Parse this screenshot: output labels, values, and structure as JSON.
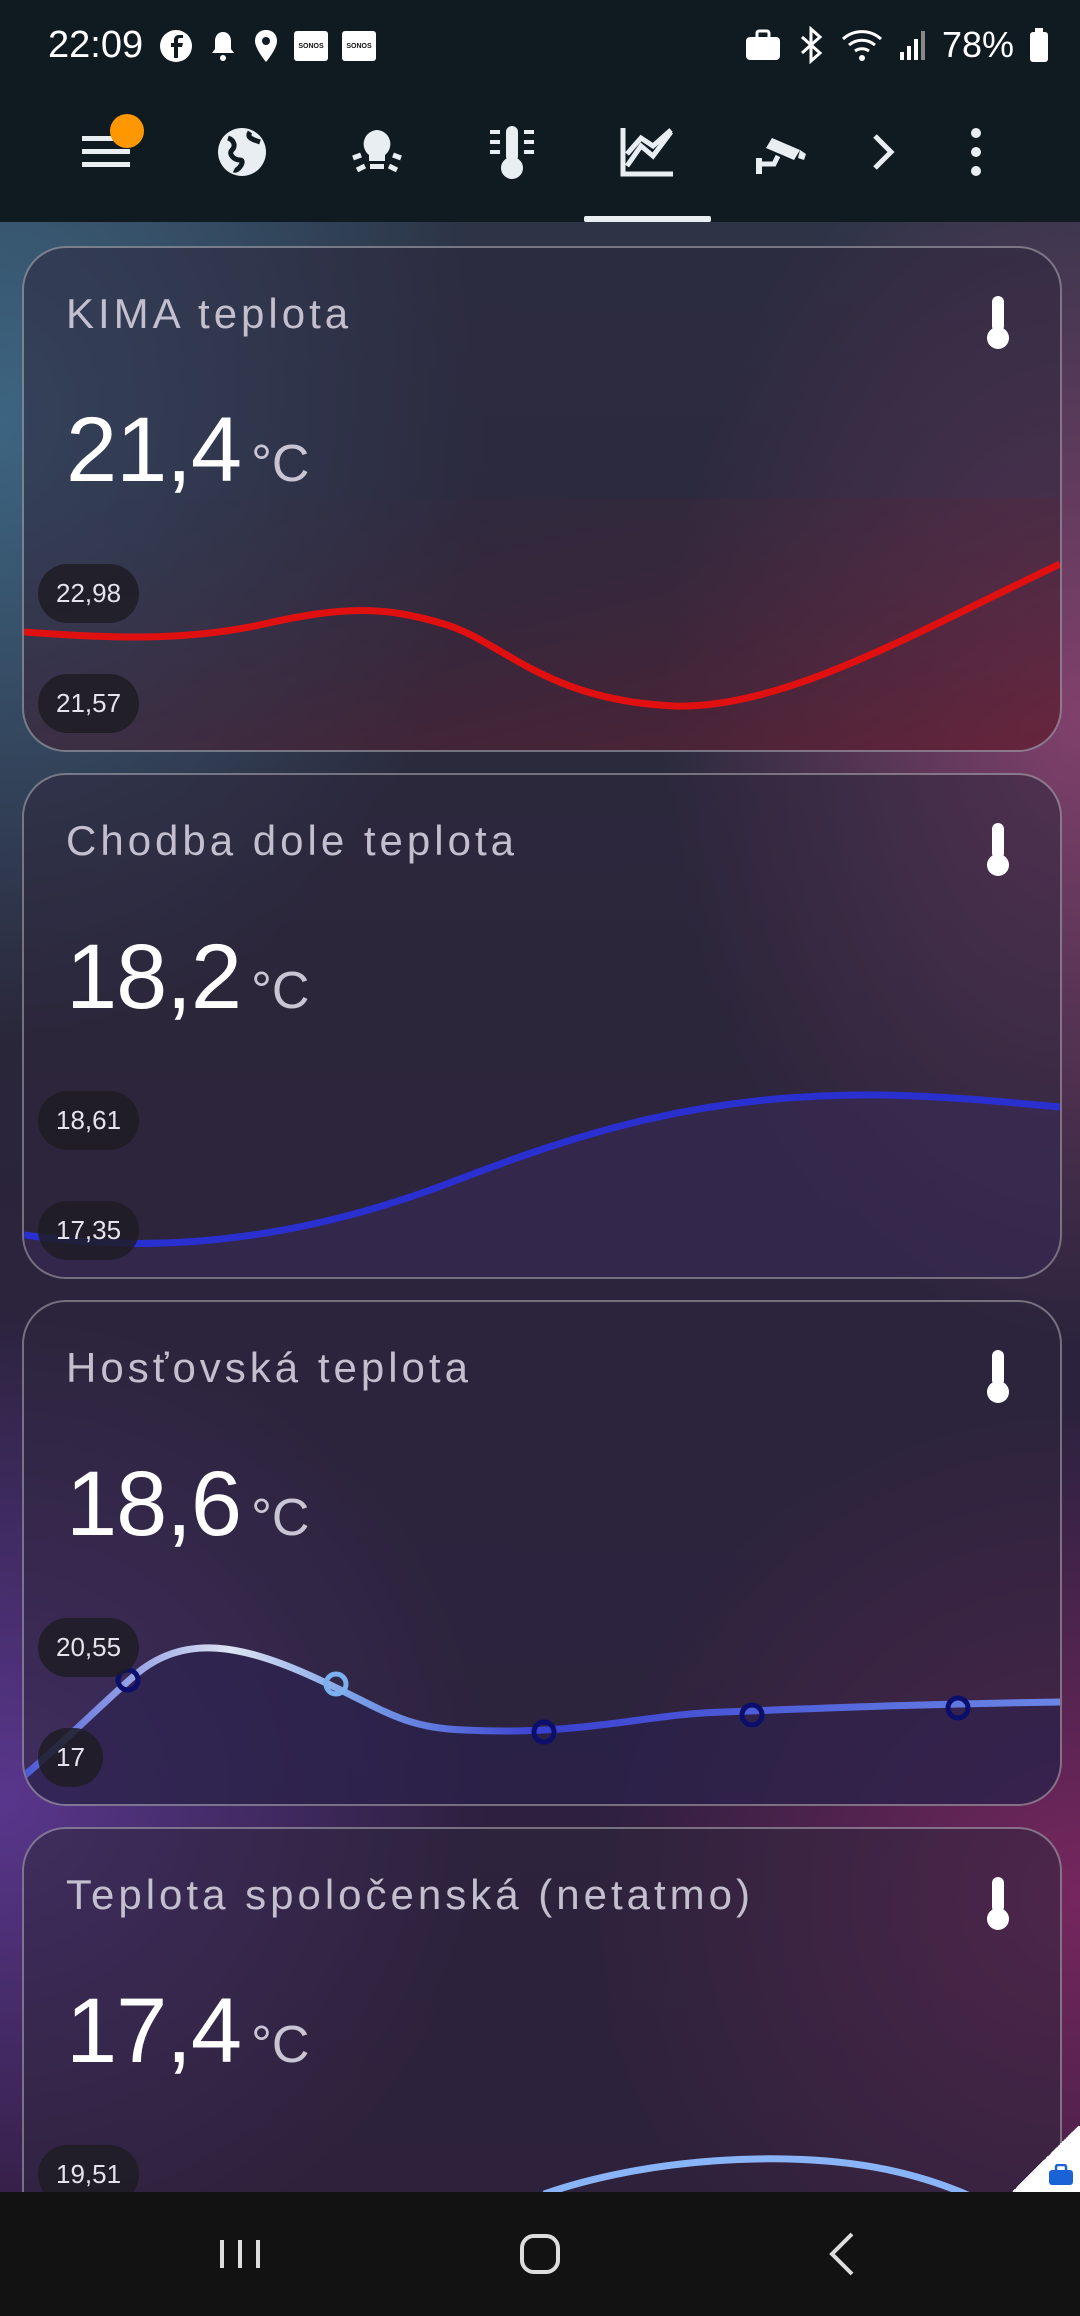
{
  "status_bar": {
    "time": "22:09",
    "battery": "78%",
    "sonos_label": "SONOS"
  },
  "toolbar": {
    "tabs": [
      "menu-icon",
      "globe-icon",
      "lights-icon",
      "thermometer-panel-icon",
      "chart-icon",
      "camera-icon",
      "chevron-right-icon",
      "more-icon"
    ],
    "active_tab": "chart-icon",
    "notification_color": "#ff9800"
  },
  "cards": [
    {
      "title": "KIMA teplota",
      "value": "21,4",
      "unit": "°C",
      "max_label": "22,98",
      "min_label": "21,57",
      "line_color": "#e01010",
      "chart_data": {
        "type": "line",
        "ylim": [
          21.57,
          22.98
        ],
        "trend": [
          22.3,
          22.25,
          22.45,
          21.9,
          21.6,
          22.9
        ]
      }
    },
    {
      "title": "Chodba dole teplota",
      "value": "18,2",
      "unit": "°C",
      "max_label": "18,61",
      "min_label": "17,35",
      "line_color": "#2a2fd0",
      "chart_data": {
        "type": "line",
        "ylim": [
          17.35,
          18.61
        ],
        "trend": [
          17.42,
          17.35,
          17.55,
          18.1,
          18.61,
          18.55
        ]
      }
    },
    {
      "title": "Hosťovská teplota",
      "value": "18,6",
      "unit": "°C",
      "max_label": "20,55",
      "min_label": "17",
      "line_color": "#5a73e0",
      "chart_data": {
        "type": "line",
        "ylim": [
          17,
          20.55
        ],
        "trend": [
          17.1,
          20.2,
          18.4,
          18.7,
          18.75,
          18.8
        ]
      }
    },
    {
      "title": "Teplota spoločenská (netatmo)",
      "value": "17,4",
      "unit": "°C",
      "max_label": "19,51",
      "min_label": "",
      "line_color": "#8ab4f8"
    }
  ]
}
